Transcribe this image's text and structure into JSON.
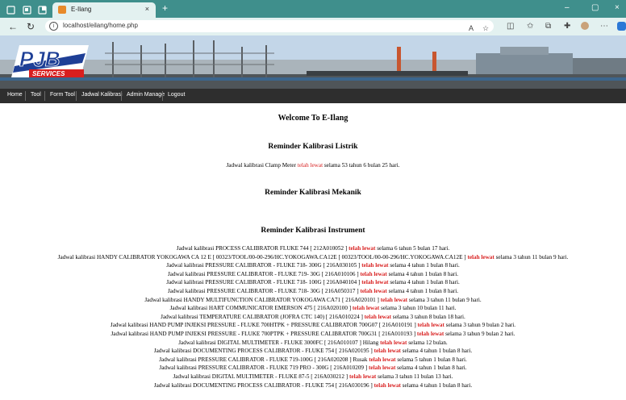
{
  "browser": {
    "tab_title": "E-Ilang",
    "tab_close": "×",
    "new_tab": "+",
    "url": "localhost/eilang/home.php",
    "minimize": "–",
    "maximize": "▢",
    "close": "×"
  },
  "nav": {
    "items": [
      "Home",
      "Tool",
      "Form Tool",
      "Jadwal Kalibrasi",
      "Admin Manage",
      "Logout"
    ]
  },
  "logo": {
    "text": "PJB",
    "sub": "SERVICES"
  },
  "welcome": "Welcome To E-Ilang",
  "listrik": {
    "heading": "Reminder Kalibrasi Listrik",
    "lines": [
      {
        "pre": "Jadwal kalibrasi Clamp Meter ",
        "mark": "telah lewat",
        "post": " selama 53 tahun 6 bulan 25 hari."
      }
    ]
  },
  "mekanik": {
    "heading": "Reminder Kalibrasi Mekanik"
  },
  "instrument": {
    "heading": "Reminder Kalibrasi Instrument",
    "lines": [
      {
        "pre": "Jadwal kalibrasi PROCESS CALIBRATOR FLUKE 744 [ 212A010052 ] ",
        "mark": "telah lewat",
        "post": " selama 6 tahun 5 bulan 17 hari."
      },
      {
        "pre": "Jadwal kalibrasi HANDY CALIBRATOR YOKOGAWA CA 12 E [ 00323/TOOL/00-00-296/HC.YOKOGAWA.CA12E [ 00323/TOOL/00-00-296/HC.YOKOGAWA.CA12E ] ",
        "mark": "telah lewat",
        "post": " selama 3 tahun 11 bulan 9 hari."
      },
      {
        "pre": "Jadwal kalibrasi PRESSURE CALIBRATOR - FLUKE 718- 300G [ 216A030105 ] ",
        "mark": "telah lewat",
        "post": " selama 4 tahun 1 bulan 8 hari."
      },
      {
        "pre": "Jadwal kalibrasi PRESSURE CALIBRATOR - FLUKE 719- 30G [ 216A010106 ] ",
        "mark": "telah lewat",
        "post": " selama 4 tahun 1 bulan 8 hari."
      },
      {
        "pre": "Jadwal kalibrasi PRESSURE CALIBRATOR - FLUKE 718- 100G [ 216A040104 ] ",
        "mark": "telah lewat",
        "post": " selama 4 tahun 1 bulan 8 hari."
      },
      {
        "pre": "Jadwal kalibrasi PRESSURE CALIBRATOR - FLUKE 718- 30G [ 216A050317 ] ",
        "mark": "telah lewat",
        "post": " selama 4 tahun 1 bulan 8 hari."
      },
      {
        "pre": "Jadwal kalibrasi HANDY MULTIFUNCTION CALIBRATOR YOKOGAWA CA71 [ 216A020101 ] ",
        "mark": "telah lewat",
        "post": " selama 3 tahun 11 bulan 9 hari."
      },
      {
        "pre": "Jadwal kalibrasi HART COMMUNICATOR EMERSON 475 [ 216A020100 ] ",
        "mark": "telah lewat",
        "post": " selama 3 tahun 10 bulan 11 hari."
      },
      {
        "pre": "Jadwal kalibrasi TEMPERATURE CALIBRATOR (JOFRA CTC 140) [ 216A010224 ] ",
        "mark": "telah lewat",
        "post": " selama 3 tahun 8 bulan 18 hari."
      },
      {
        "pre": "Jadwal kalibrasi HAND PUMP INJEKSI PRESSURE - FLUKE 700HTPK + PRESSURE CALIBRATOR 700G07 [ 216A010191 ] ",
        "mark": "telah lewat",
        "post": " selama 3 tahun 9 bulan 2 hari."
      },
      {
        "pre": "Jadwal kalibrasi HAND PUMP INJEKSI PRESSURE - FLUKE 700PTPK + PRESSURE CALIBRATOR 700G31 [ 216A010193 ] ",
        "mark": "telah lewat",
        "post": " selama 3 tahun 9 bulan 2 hari."
      },
      {
        "pre": "Jadwal kalibrasi DIGITAL MULTIMETER - FLUKE 3000FC [ 216A010107 ] Hilang ",
        "mark": "telah lewat",
        "post": " selama 12 bulan."
      },
      {
        "pre": "Jadwal kalibrasi DOCUMENTING PROCESS CALIBRATOR - FLUKE 754 [ 216A020195 ] ",
        "mark": "telah lewat",
        "post": " selama 4 tahun 1 bulan 8 hari."
      },
      {
        "pre": "Jadwal kalibrasi PRESSURE CALIBRATOR - FLUKE 719-100G [ 216A020208 ] Rusak ",
        "mark": "telah lewat",
        "post": " selama 5 tahun 1 bulan 8 hari."
      },
      {
        "pre": "Jadwal kalibrasi PRESSURE CALIBRATOR - FLUKE 719 PRO - 300G [ 216A010209 ] ",
        "mark": "telah lewat",
        "post": " selama 4 tahun 1 bulan 8 hari."
      },
      {
        "pre": "Jadwal kalibrasi DIGITAL MULTIMETER - FLUKE 87-5 [ 216A030212 ] ",
        "mark": "telah lewat",
        "post": " selama 3 tahun 11 bulan 13 hari."
      },
      {
        "pre": "Jadwal kalibrasi DOCUMENTING PROCESS CALIBRATOR - FLUKE 754 [ 216A030196 ] ",
        "mark": "telah lewat",
        "post": " selama 4 tahun 1 bulan 8 hari."
      }
    ]
  },
  "colors": {
    "accent_red": "#d81e1e",
    "menu_bg": "#2e2e2e",
    "tabbar": "#3f8f8c"
  }
}
